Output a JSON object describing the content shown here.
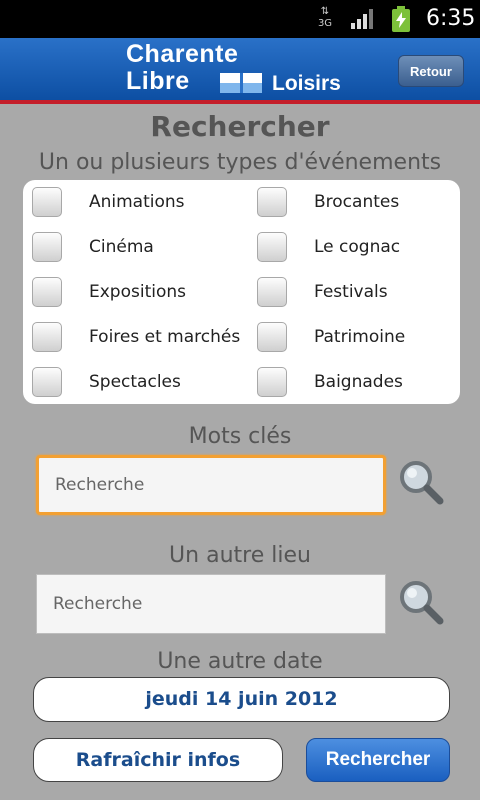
{
  "status_bar": {
    "network": "3G",
    "time": "6:35"
  },
  "header": {
    "logo_line1": "Charente",
    "logo_line2": "Libre",
    "logo_line3": "Loisirs",
    "back_label": "Retour",
    "brand_blue": "#0d4fa3",
    "accent_red": "#c41e2a"
  },
  "page": {
    "title": "Rechercher",
    "types_title": "Un ou plusieurs types d'événements"
  },
  "categories": [
    {
      "label": "Animations",
      "checked": false
    },
    {
      "label": "Brocantes",
      "checked": false
    },
    {
      "label": "Cinéma",
      "checked": false
    },
    {
      "label": "Le cognac",
      "checked": false
    },
    {
      "label": "Expositions",
      "checked": false
    },
    {
      "label": "Festivals",
      "checked": false
    },
    {
      "label": "Foires et marchés",
      "checked": false
    },
    {
      "label": "Patrimoine",
      "checked": false
    },
    {
      "label": "Spectacles",
      "checked": false
    },
    {
      "label": "Baignades",
      "checked": false
    }
  ],
  "keywords": {
    "label": "Mots clés",
    "placeholder": "Recherche",
    "value": ""
  },
  "location": {
    "label": "Un autre lieu",
    "placeholder": "Recherche",
    "value": ""
  },
  "date": {
    "label": "Une autre date",
    "value": "jeudi 14 juin 2012"
  },
  "actions": {
    "refresh_label": "Rafraîchir infos",
    "search_label": "Rechercher"
  }
}
